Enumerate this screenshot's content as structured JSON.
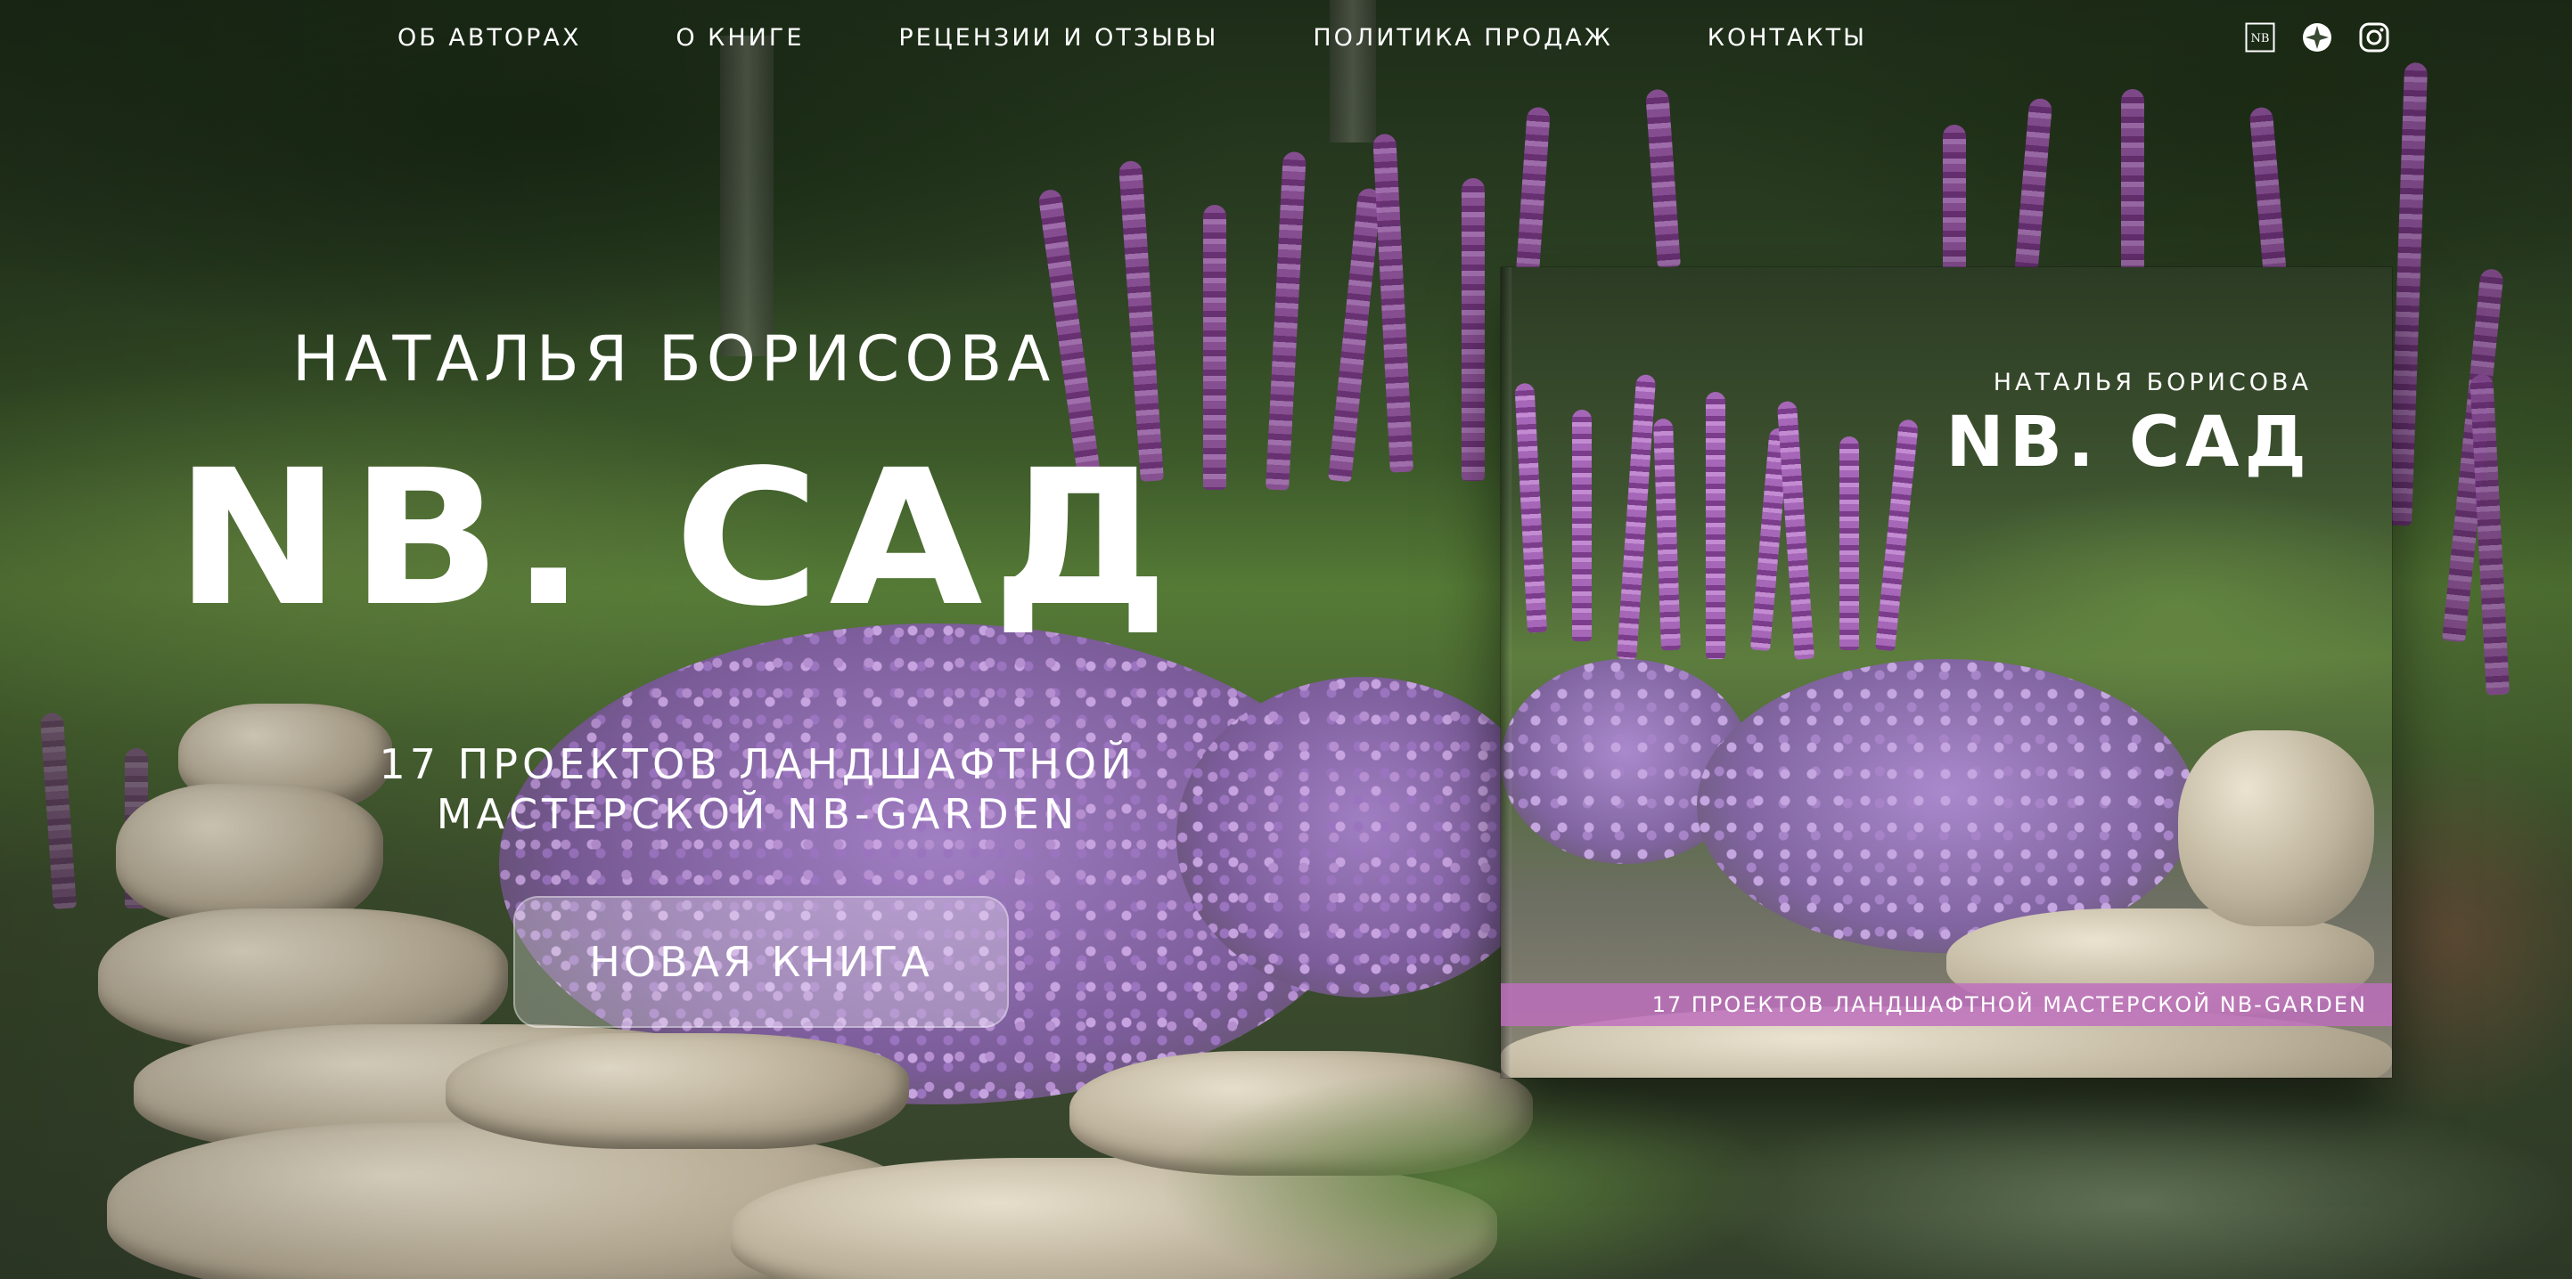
{
  "nav": {
    "items": [
      {
        "label": "ОБ АВТОРАХ"
      },
      {
        "label": "О КНИГЕ"
      },
      {
        "label": "РЕЦЕНЗИИ И ОТЗЫВЫ"
      },
      {
        "label": "ПОЛИТИКА ПРОДАЖ"
      },
      {
        "label": "КОНТАКТЫ"
      }
    ]
  },
  "social": {
    "nb_logo_text": "NB",
    "icons": [
      "nb-logo-icon",
      "compass-star-icon",
      "instagram-icon"
    ]
  },
  "hero": {
    "author": "НАТАЛЬЯ БОРИСОВА",
    "title": "NB. САД",
    "subtitle_line1": "17 ПРОЕКТОВ ЛАНДШАФТНОЙ",
    "subtitle_line2": "МАСТЕРСКОЙ NB-GARDEN",
    "cta_label": "НОВАЯ КНИГА"
  },
  "book": {
    "author": "НАТАЛЬЯ БОРИСОВА",
    "title": "NB. САД",
    "band_text": "17 ПРОЕКТОВ ЛАНДШАФТНОЙ МАСТЕРСКОЙ NB-GARDEN"
  },
  "colors": {
    "text": "#ffffff",
    "band": "#be6ebe",
    "accent_purple": "#8d4f9a",
    "foliage": "#3d5a2a"
  }
}
